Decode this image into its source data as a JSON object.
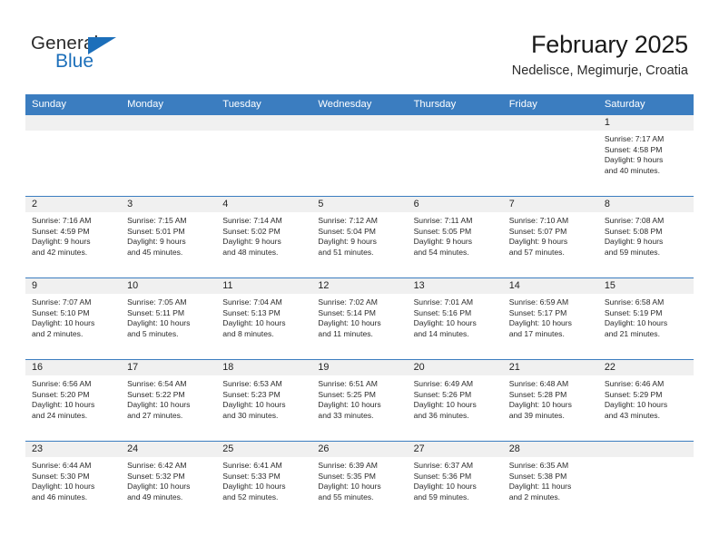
{
  "brand": {
    "name_top": "General",
    "name_bottom": "Blue",
    "accent_color": "#1c6fba"
  },
  "header": {
    "title": "February 2025",
    "subtitle": "Nedelisce, Megimurje, Croatia"
  },
  "theme": {
    "header_row_bg": "#3b7dc0",
    "daynum_bg": "#f0f0f0",
    "cell_bg": "#ffffff",
    "row_divider": "#3b7dc0"
  },
  "weekdays": [
    "Sunday",
    "Monday",
    "Tuesday",
    "Wednesday",
    "Thursday",
    "Friday",
    "Saturday"
  ],
  "labels": {
    "sunrise_prefix": "Sunrise:",
    "sunset_prefix": "Sunset:",
    "daylight_prefix": "Daylight:"
  },
  "weeks": [
    [
      {
        "day": "",
        "line1": "",
        "line2": "",
        "line3": "",
        "line4": ""
      },
      {
        "day": "",
        "line1": "",
        "line2": "",
        "line3": "",
        "line4": ""
      },
      {
        "day": "",
        "line1": "",
        "line2": "",
        "line3": "",
        "line4": ""
      },
      {
        "day": "",
        "line1": "",
        "line2": "",
        "line3": "",
        "line4": ""
      },
      {
        "day": "",
        "line1": "",
        "line2": "",
        "line3": "",
        "line4": ""
      },
      {
        "day": "",
        "line1": "",
        "line2": "",
        "line3": "",
        "line4": ""
      },
      {
        "day": "1",
        "line1": "Sunrise: 7:17 AM",
        "line2": "Sunset: 4:58 PM",
        "line3": "Daylight: 9 hours",
        "line4": "and 40 minutes."
      }
    ],
    [
      {
        "day": "2",
        "line1": "Sunrise: 7:16 AM",
        "line2": "Sunset: 4:59 PM",
        "line3": "Daylight: 9 hours",
        "line4": "and 42 minutes."
      },
      {
        "day": "3",
        "line1": "Sunrise: 7:15 AM",
        "line2": "Sunset: 5:01 PM",
        "line3": "Daylight: 9 hours",
        "line4": "and 45 minutes."
      },
      {
        "day": "4",
        "line1": "Sunrise: 7:14 AM",
        "line2": "Sunset: 5:02 PM",
        "line3": "Daylight: 9 hours",
        "line4": "and 48 minutes."
      },
      {
        "day": "5",
        "line1": "Sunrise: 7:12 AM",
        "line2": "Sunset: 5:04 PM",
        "line3": "Daylight: 9 hours",
        "line4": "and 51 minutes."
      },
      {
        "day": "6",
        "line1": "Sunrise: 7:11 AM",
        "line2": "Sunset: 5:05 PM",
        "line3": "Daylight: 9 hours",
        "line4": "and 54 minutes."
      },
      {
        "day": "7",
        "line1": "Sunrise: 7:10 AM",
        "line2": "Sunset: 5:07 PM",
        "line3": "Daylight: 9 hours",
        "line4": "and 57 minutes."
      },
      {
        "day": "8",
        "line1": "Sunrise: 7:08 AM",
        "line2": "Sunset: 5:08 PM",
        "line3": "Daylight: 9 hours",
        "line4": "and 59 minutes."
      }
    ],
    [
      {
        "day": "9",
        "line1": "Sunrise: 7:07 AM",
        "line2": "Sunset: 5:10 PM",
        "line3": "Daylight: 10 hours",
        "line4": "and 2 minutes."
      },
      {
        "day": "10",
        "line1": "Sunrise: 7:05 AM",
        "line2": "Sunset: 5:11 PM",
        "line3": "Daylight: 10 hours",
        "line4": "and 5 minutes."
      },
      {
        "day": "11",
        "line1": "Sunrise: 7:04 AM",
        "line2": "Sunset: 5:13 PM",
        "line3": "Daylight: 10 hours",
        "line4": "and 8 minutes."
      },
      {
        "day": "12",
        "line1": "Sunrise: 7:02 AM",
        "line2": "Sunset: 5:14 PM",
        "line3": "Daylight: 10 hours",
        "line4": "and 11 minutes."
      },
      {
        "day": "13",
        "line1": "Sunrise: 7:01 AM",
        "line2": "Sunset: 5:16 PM",
        "line3": "Daylight: 10 hours",
        "line4": "and 14 minutes."
      },
      {
        "day": "14",
        "line1": "Sunrise: 6:59 AM",
        "line2": "Sunset: 5:17 PM",
        "line3": "Daylight: 10 hours",
        "line4": "and 17 minutes."
      },
      {
        "day": "15",
        "line1": "Sunrise: 6:58 AM",
        "line2": "Sunset: 5:19 PM",
        "line3": "Daylight: 10 hours",
        "line4": "and 21 minutes."
      }
    ],
    [
      {
        "day": "16",
        "line1": "Sunrise: 6:56 AM",
        "line2": "Sunset: 5:20 PM",
        "line3": "Daylight: 10 hours",
        "line4": "and 24 minutes."
      },
      {
        "day": "17",
        "line1": "Sunrise: 6:54 AM",
        "line2": "Sunset: 5:22 PM",
        "line3": "Daylight: 10 hours",
        "line4": "and 27 minutes."
      },
      {
        "day": "18",
        "line1": "Sunrise: 6:53 AM",
        "line2": "Sunset: 5:23 PM",
        "line3": "Daylight: 10 hours",
        "line4": "and 30 minutes."
      },
      {
        "day": "19",
        "line1": "Sunrise: 6:51 AM",
        "line2": "Sunset: 5:25 PM",
        "line3": "Daylight: 10 hours",
        "line4": "and 33 minutes."
      },
      {
        "day": "20",
        "line1": "Sunrise: 6:49 AM",
        "line2": "Sunset: 5:26 PM",
        "line3": "Daylight: 10 hours",
        "line4": "and 36 minutes."
      },
      {
        "day": "21",
        "line1": "Sunrise: 6:48 AM",
        "line2": "Sunset: 5:28 PM",
        "line3": "Daylight: 10 hours",
        "line4": "and 39 minutes."
      },
      {
        "day": "22",
        "line1": "Sunrise: 6:46 AM",
        "line2": "Sunset: 5:29 PM",
        "line3": "Daylight: 10 hours",
        "line4": "and 43 minutes."
      }
    ],
    [
      {
        "day": "23",
        "line1": "Sunrise: 6:44 AM",
        "line2": "Sunset: 5:30 PM",
        "line3": "Daylight: 10 hours",
        "line4": "and 46 minutes."
      },
      {
        "day": "24",
        "line1": "Sunrise: 6:42 AM",
        "line2": "Sunset: 5:32 PM",
        "line3": "Daylight: 10 hours",
        "line4": "and 49 minutes."
      },
      {
        "day": "25",
        "line1": "Sunrise: 6:41 AM",
        "line2": "Sunset: 5:33 PM",
        "line3": "Daylight: 10 hours",
        "line4": "and 52 minutes."
      },
      {
        "day": "26",
        "line1": "Sunrise: 6:39 AM",
        "line2": "Sunset: 5:35 PM",
        "line3": "Daylight: 10 hours",
        "line4": "and 55 minutes."
      },
      {
        "day": "27",
        "line1": "Sunrise: 6:37 AM",
        "line2": "Sunset: 5:36 PM",
        "line3": "Daylight: 10 hours",
        "line4": "and 59 minutes."
      },
      {
        "day": "28",
        "line1": "Sunrise: 6:35 AM",
        "line2": "Sunset: 5:38 PM",
        "line3": "Daylight: 11 hours",
        "line4": "and 2 minutes."
      },
      {
        "day": "",
        "line1": "",
        "line2": "",
        "line3": "",
        "line4": ""
      }
    ]
  ]
}
